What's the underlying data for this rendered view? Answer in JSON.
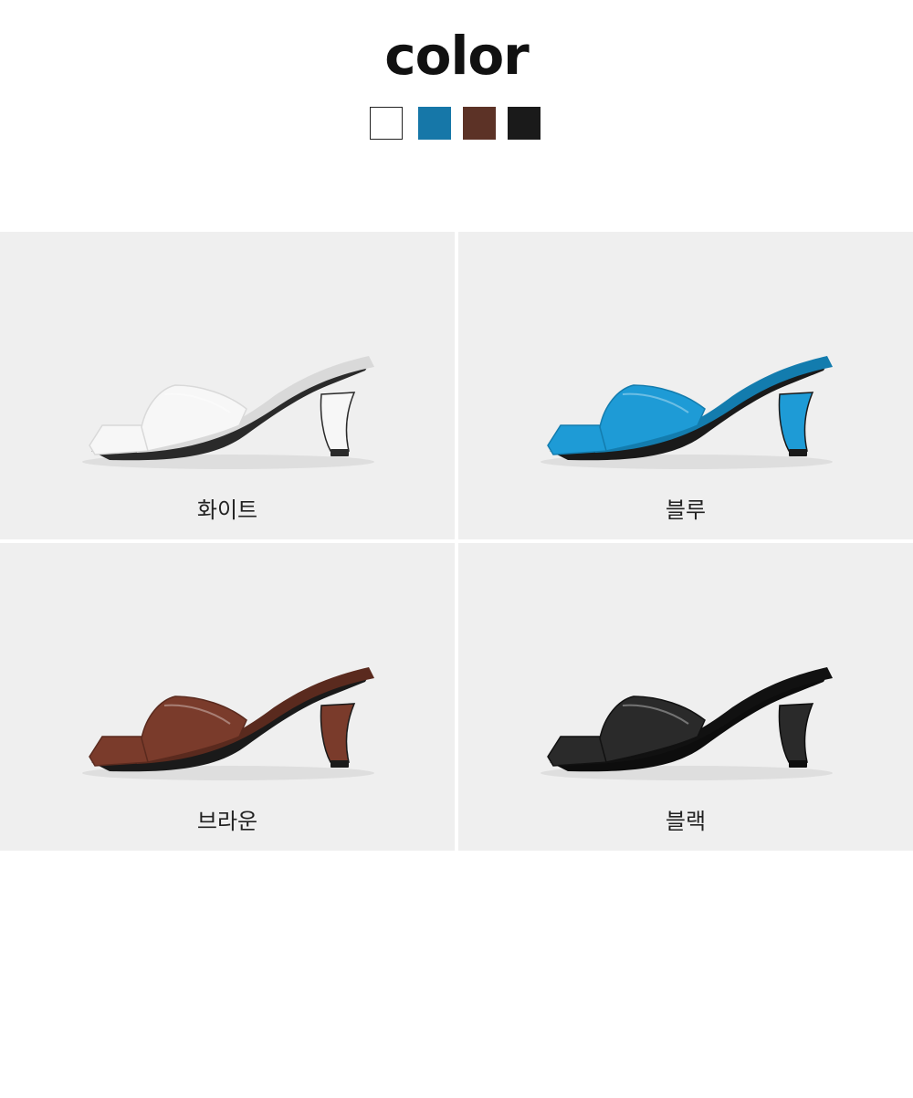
{
  "header": {
    "title": "color"
  },
  "swatches": [
    {
      "name": "white-swatch",
      "color": "#ffffff",
      "border": "#222222"
    },
    {
      "name": "blue-swatch",
      "color": "#1677a8",
      "border": "#1677a8"
    },
    {
      "name": "brown-swatch",
      "color": "#5c3226",
      "border": "#5c3226"
    },
    {
      "name": "black-swatch",
      "color": "#1a1a1a",
      "border": "#1a1a1a"
    }
  ],
  "products": [
    {
      "label": "화이트",
      "color": "#f7f7f7",
      "shade": "#d9d9d9",
      "sole": "#2a2a2a"
    },
    {
      "label": "블루",
      "color": "#1e9bd6",
      "shade": "#137cae",
      "sole": "#1a1a1a"
    },
    {
      "label": "브라운",
      "color": "#7a3b2b",
      "shade": "#5a2a1e",
      "sole": "#1a1a1a"
    },
    {
      "label": "블랙",
      "color": "#2a2a2a",
      "shade": "#111111",
      "sole": "#0d0d0d"
    }
  ]
}
